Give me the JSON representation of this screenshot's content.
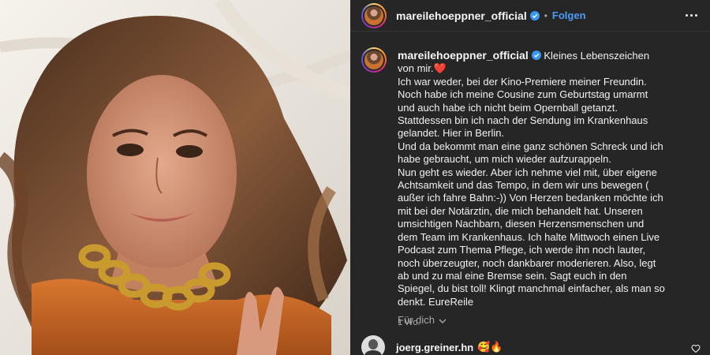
{
  "post": {
    "author": "mareilehoeppner_official",
    "follow_label": "Folgen",
    "more_icon": "more-horizontal-icon",
    "caption_first_line": "Kleines Lebenszeichen von mir.❤️",
    "caption_body": "Ich war weder, bei der Kino-Premiere meiner Freundin.\nNoch habe ich meine Cousine zum Geburtstag umarmt und auch habe ich nicht beim Opernball getanzt.\nStattdessen bin ich nach der Sendung im Krankenhaus gelandet. Hier in Berlin.\nUnd da bekommt man eine ganz schönen Schreck und ich habe gebraucht, um mich wieder aufzurappeln.\nNun geht es wieder. Aber ich nehme viel mit, über eigene Achtsamkeit und das Tempo, in dem wir uns bewegen ( außer ich fahre Bahn:-)) Von Herzen bedanken möchte ich mit bei der Notärztin, die mich behandelt hat. Unseren umsichtigen Nachbarn, diesen Herzensmenschen und dem Team im Krankenhaus. Ich halte Mittwoch einen Live Podcast zum Thema Pflege, ich werde ihn noch lauter, noch überzeugter, noch dankbarer moderieren. Also, legt ab und zu mal eine Bremse sein. Sagt euch in den Spiegel, du bist toll! Klingt manchmal einfacher, als man so denkt. EureReile",
    "timestamp": "1 Wo.",
    "translate_label": "Für dich"
  },
  "comments": [
    {
      "user": "joerg.greiner.hn",
      "text": "🥰🔥"
    }
  ],
  "colors": {
    "panel_bg": "#262626",
    "accent_blue": "#4a9df8",
    "muted_text": "#a8a8a8",
    "photo_top": "orange top, gold chain necklace"
  }
}
